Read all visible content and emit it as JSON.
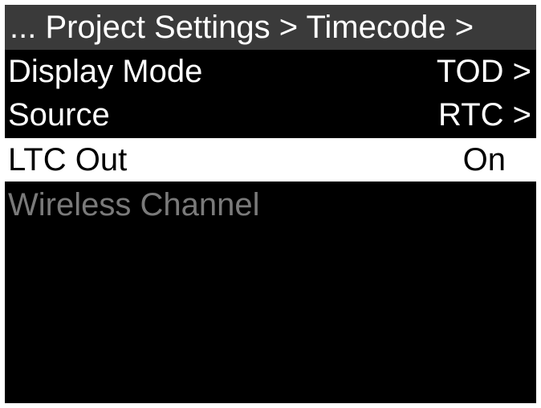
{
  "header": {
    "title": "... Project Settings > Timecode >"
  },
  "menu": {
    "items": [
      {
        "label": "Display Mode",
        "value": "TOD >"
      },
      {
        "label": "Source",
        "value": "RTC >"
      },
      {
        "label": "LTC Out",
        "value": "On"
      },
      {
        "label": "Wireless Channel",
        "value": ""
      }
    ]
  },
  "colors": {
    "background": "#000000",
    "title_bar": "#3a3a3a",
    "selected_background": "#ffffff",
    "disabled_text": "#7a7a7a"
  }
}
